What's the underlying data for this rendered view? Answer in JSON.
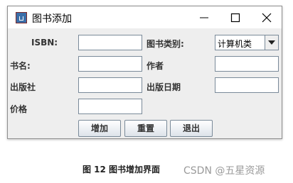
{
  "window": {
    "title": "图书添加",
    "minimize_icon": "minimize-icon",
    "maximize_icon": "maximize-icon",
    "close_icon": "close-icon"
  },
  "form": {
    "isbn_label": "ISBN:",
    "category_label": "图书类别:",
    "category_value": "计算机类",
    "name_label": "书名:",
    "author_label": "作者",
    "publisher_label": "出版社",
    "pubdate_label": "出版日期",
    "price_label": "价格"
  },
  "buttons": {
    "add": "增加",
    "reset": "重置",
    "exit": "退出"
  },
  "caption": "图 12 图书增加界面",
  "watermark": "CSDN @五星资源"
}
